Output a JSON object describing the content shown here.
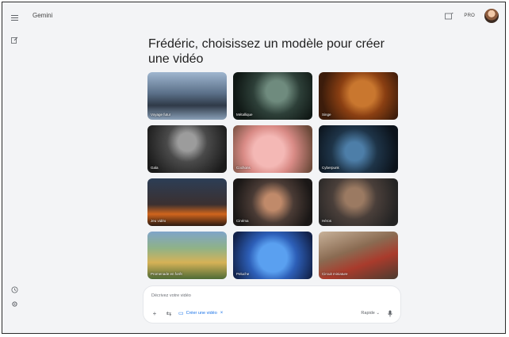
{
  "app": {
    "title": "Gemini",
    "plan": "PRO"
  },
  "sidebar": {
    "menu_icon": "menu-icon",
    "new_chat_icon": "edit-icon",
    "history_icon": "history-icon",
    "settings_icon": "settings-icon"
  },
  "topbar": {
    "cast_icon": "cast-icon"
  },
  "main": {
    "headline_line1": "Frédéric, choisissez un modèle pour créer",
    "headline_line2": "une vidéo",
    "templates": [
      {
        "label": "Voyage futur"
      },
      {
        "label": "Métallique"
      },
      {
        "label": "Singe"
      },
      {
        "label": "Gala"
      },
      {
        "label": "Cochons"
      },
      {
        "label": "Cyberpunk"
      },
      {
        "label": "Jeu vidéo"
      },
      {
        "label": "Cinéma"
      },
      {
        "label": "Héros"
      },
      {
        "label": "Promenade en forêt"
      },
      {
        "label": "Peluche"
      },
      {
        "label": "Circuit miniature"
      }
    ]
  },
  "composer": {
    "placeholder": "Décrivez votre vidéo",
    "chip_label": "Créer une vidéo",
    "mode_label": "Rapide",
    "colors": {
      "accent": "#1a73e8"
    }
  }
}
